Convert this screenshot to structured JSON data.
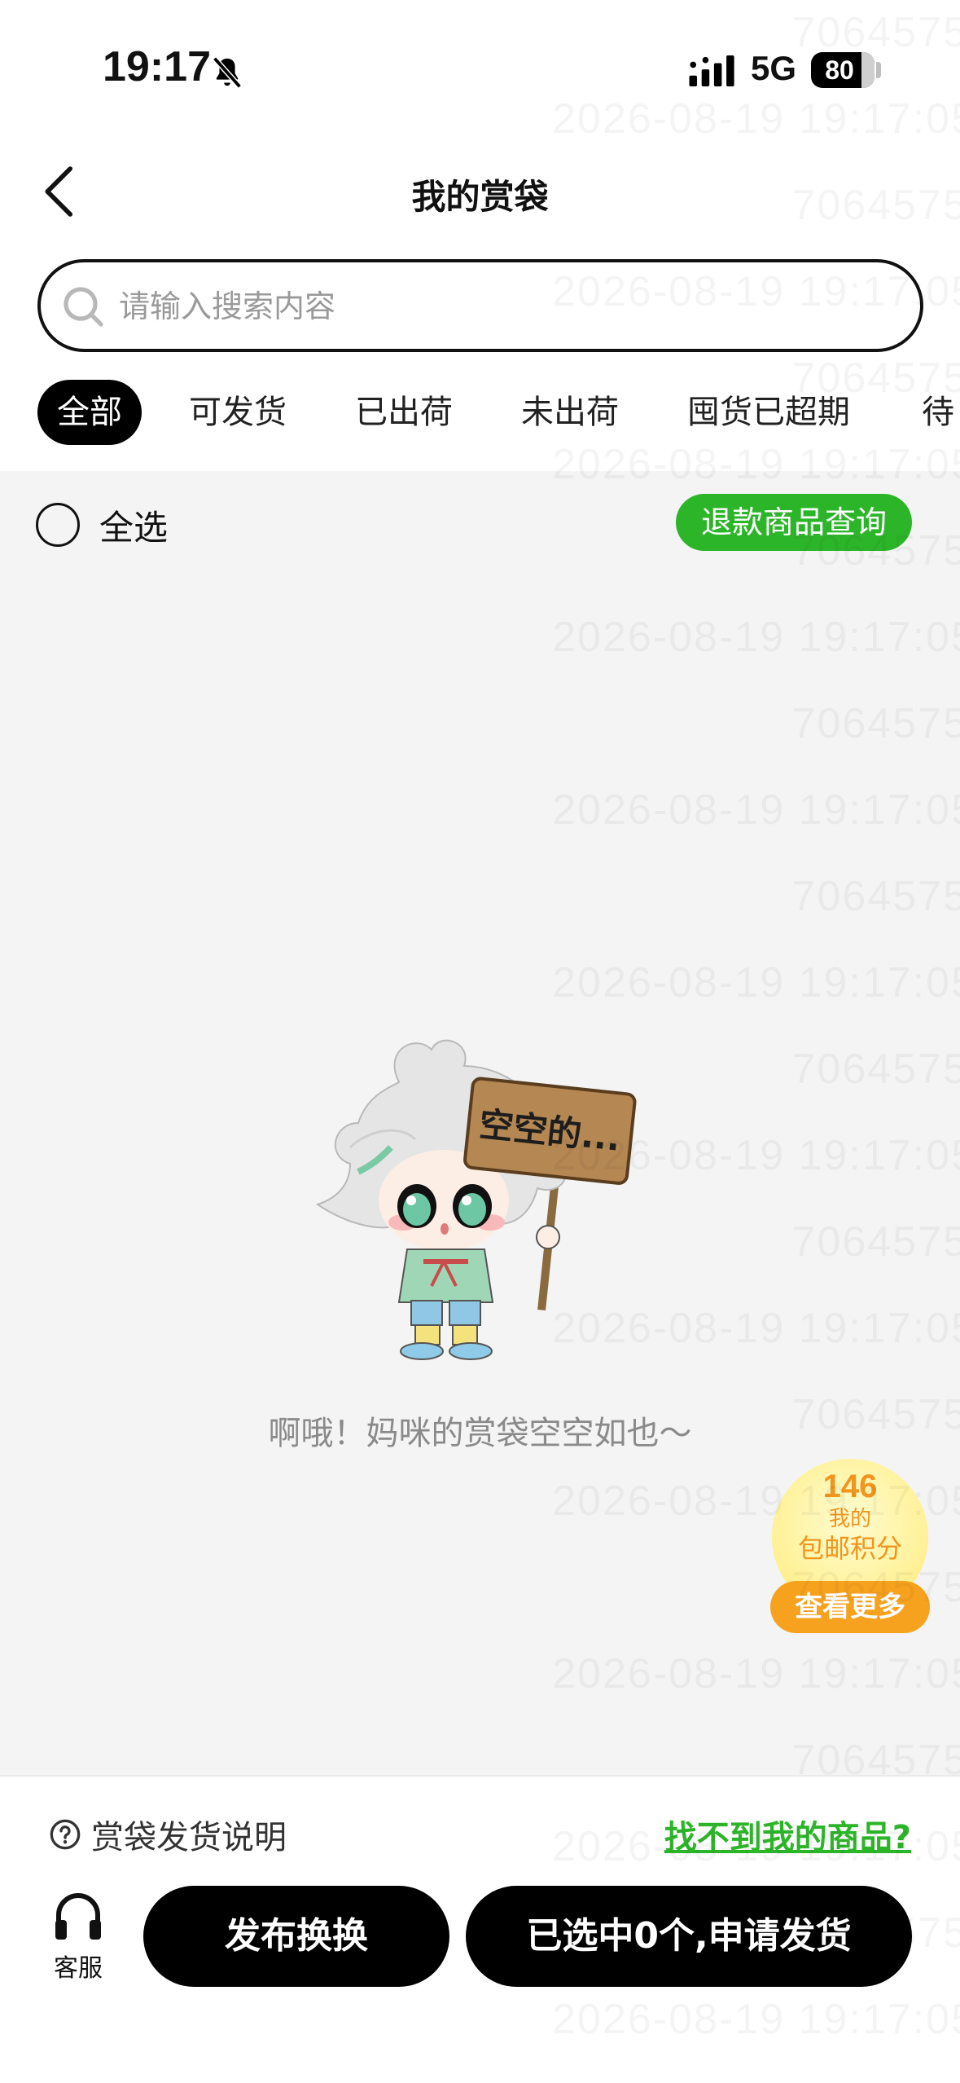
{
  "status_bar": {
    "time": "19:17",
    "network": "5G",
    "battery": "80",
    "battery_level": 0.8
  },
  "nav": {
    "title": "我的赏袋",
    "back_icon": "chevron-left-icon"
  },
  "search": {
    "placeholder": "请输入搜索内容",
    "value": ""
  },
  "tabs": [
    {
      "label": "全部",
      "active": true
    },
    {
      "label": "可发货",
      "active": false
    },
    {
      "label": "已出荷",
      "active": false
    },
    {
      "label": "未出荷",
      "active": false
    },
    {
      "label": "囤货已超期",
      "active": false
    },
    {
      "label": "待",
      "active": false
    }
  ],
  "toolbar": {
    "select_all_label": "全选",
    "refund_query_label": "退款商品查询"
  },
  "empty_state": {
    "sign_text": "空空的...",
    "message": "啊哦！妈咪的赏袋空空如也～"
  },
  "points_widget": {
    "points": "146",
    "sub": "我的",
    "label": "包邮积分",
    "more_label": "查看更多"
  },
  "footer": {
    "help_label": "赏袋发货说明",
    "not_found_label": "找不到我的商品?",
    "service_label": "客服",
    "exchange_label": "发布换换",
    "ship_label": "已选中0个,申请发货"
  },
  "watermark": {
    "lines": [
      "7064575",
      "2026-08-19 19:17:05"
    ]
  },
  "colors": {
    "accent_green": "#2db52a",
    "primary_black": "#000000",
    "points_orange": "#f7a21f",
    "content_bg": "#f4f4f4"
  }
}
